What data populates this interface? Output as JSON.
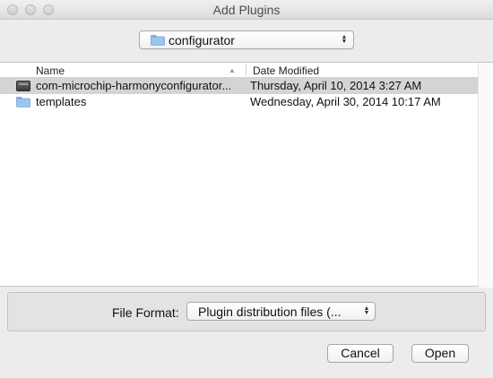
{
  "window": {
    "title": "Add Plugins"
  },
  "path_popup": {
    "selected": "configurator",
    "icon": "folder-icon"
  },
  "file_list": {
    "columns": [
      "Name",
      "Date Modified"
    ],
    "sort_column": "Name",
    "rows": [
      {
        "name": "com-microchip-harmonyconfigurator...",
        "date_modified": "Thursday, April 10, 2014 3:27 AM",
        "icon": "archive-icon",
        "selected": true
      },
      {
        "name": "templates",
        "date_modified": "Wednesday, April 30, 2014 10:17 AM",
        "icon": "folder-icon",
        "selected": false
      }
    ]
  },
  "file_format": {
    "label": "File Format:",
    "selected": "Plugin distribution files (..."
  },
  "buttons": {
    "cancel": "Cancel",
    "open": "Open"
  },
  "colors": {
    "window_bg": "#ececec",
    "selection": "#d4d4d4",
    "folder": "#8ab6e6"
  }
}
